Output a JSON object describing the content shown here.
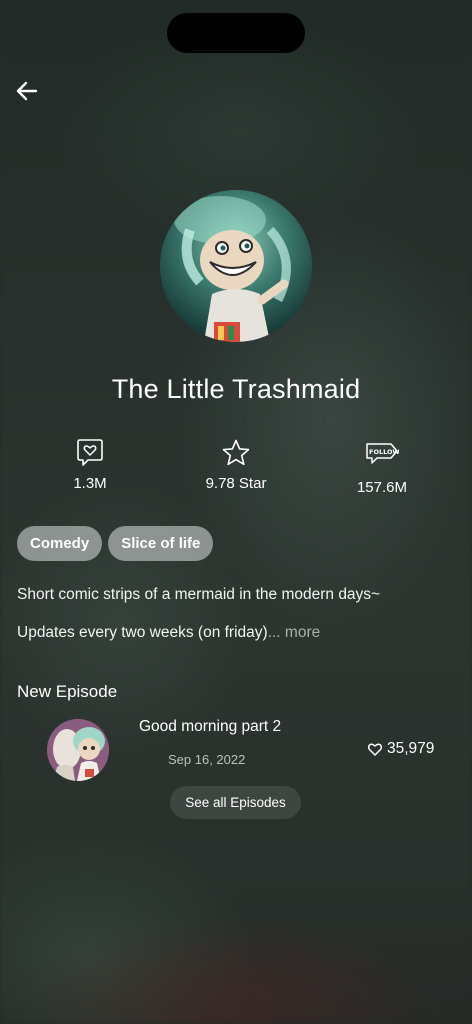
{
  "header": {
    "back_icon": "arrow-left-icon"
  },
  "series": {
    "title": "The Little Trashmaid",
    "cover_icon": "series-cover-art"
  },
  "stats": {
    "likes": {
      "icon": "heart-bubble-icon",
      "value": "1.3M"
    },
    "rating": {
      "icon": "star-icon",
      "value": "9.78 Star"
    },
    "followers": {
      "icon": "follow-tag-icon",
      "icon_text": "FOLLOW",
      "value": "157.6M"
    }
  },
  "tags": [
    "Comedy",
    "Slice of life"
  ],
  "description": {
    "line1": "Short comic strips of a mermaid in the modern days~",
    "line2": "Updates every two weeks (on friday)",
    "more_label": "... more"
  },
  "new_episode": {
    "section_title": "New Episode",
    "title": "Good morning part 2",
    "date": "Sep 16, 2022",
    "likes": "35,979",
    "like_icon": "heart-outline-icon",
    "thumb_icon": "episode-thumbnail"
  },
  "see_all_label": "See all Episodes",
  "colors": {
    "background": "#2b332f",
    "tag_bg": "#c8cdcb",
    "muted_text": "#a9b1ae",
    "pill_bg": "#464e4a"
  }
}
